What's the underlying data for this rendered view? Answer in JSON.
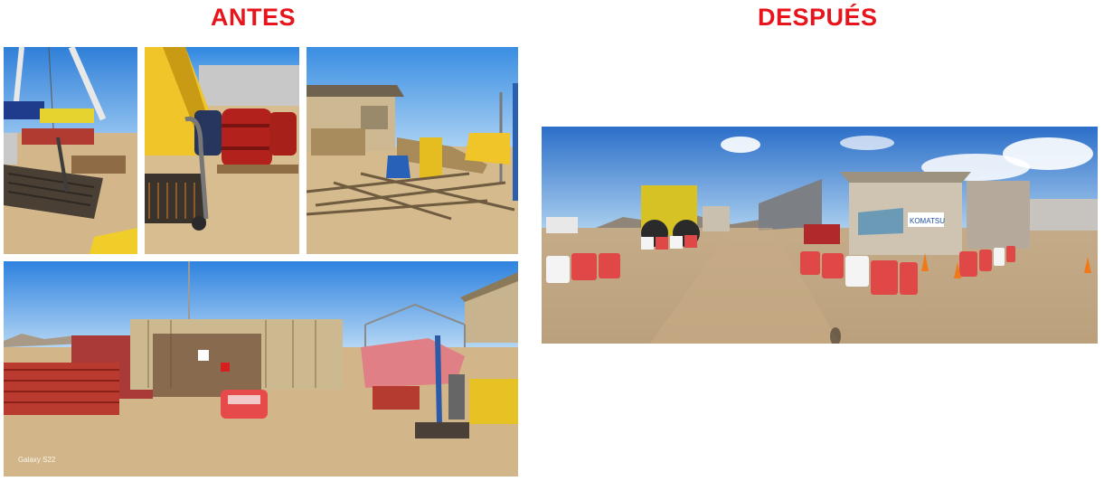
{
  "headings": {
    "before": "ANTES",
    "after": "DESPUÉS"
  },
  "photos": {
    "before_1": {
      "subject": "crane-and-scrap-metal"
    },
    "before_2": {
      "subject": "oil-drums-and-cart"
    },
    "before_3": {
      "subject": "cabin-and-scattered-debris"
    },
    "before_4": {
      "subject": "containers-and-barriers-yard",
      "watermark": "Galaxy S22"
    },
    "after_1": {
      "subject": "organized-yard-panorama",
      "sign_text": "KOMATSU"
    }
  },
  "colors": {
    "heading": "#e8141b",
    "sky": "#3f8fe0",
    "ground": "#d6bd93"
  }
}
